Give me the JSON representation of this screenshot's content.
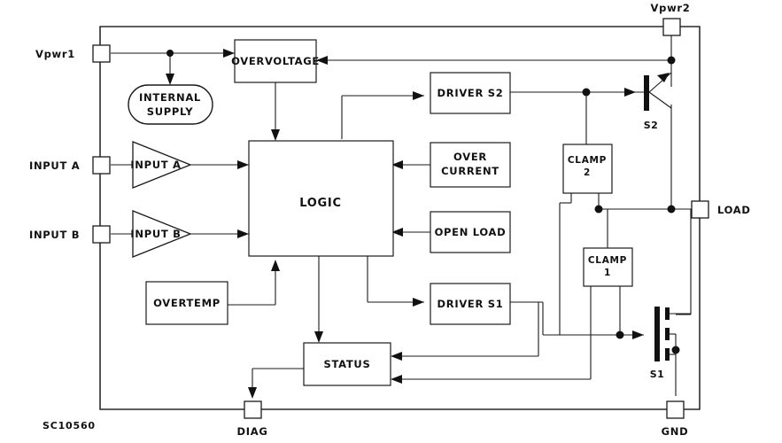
{
  "diagram": {
    "part_number": "SC10560",
    "title": "",
    "line_color": "#1a1a1a",
    "background_color": "#ffffff"
  },
  "terminals": [
    {
      "id": "vpwr1",
      "label": "Vpwr1",
      "side": "left"
    },
    {
      "id": "input_a",
      "label": "INPUT A",
      "side": "left"
    },
    {
      "id": "input_b",
      "label": "INPUT B",
      "side": "left"
    },
    {
      "id": "vpwr2",
      "label": "Vpwr2",
      "side": "top"
    },
    {
      "id": "load",
      "label": "LOAD",
      "side": "right"
    },
    {
      "id": "gnd",
      "label": "GND",
      "side": "bottom"
    },
    {
      "id": "diag",
      "label": "DIAG",
      "side": "bottom"
    }
  ],
  "blocks": [
    {
      "id": "overvoltage",
      "label": "OVERVOLTAGE",
      "shape": "rect"
    },
    {
      "id": "internal_supply",
      "label_line1": "INTERNAL",
      "label_line2": "SUPPLY",
      "shape": "rounded"
    },
    {
      "id": "input_a_buffer",
      "label": "INPUT A",
      "shape": "triangle"
    },
    {
      "id": "input_b_buffer",
      "label": "INPUT B",
      "shape": "triangle"
    },
    {
      "id": "logic",
      "label": "LOGIC",
      "shape": "rect"
    },
    {
      "id": "overtemp",
      "label": "OVERTEMP",
      "shape": "rect"
    },
    {
      "id": "status",
      "label": "STATUS",
      "shape": "rect"
    },
    {
      "id": "driver_s2",
      "label": "DRIVER  S2",
      "shape": "rect"
    },
    {
      "id": "driver_s1",
      "label": "DRIVER  S1",
      "shape": "rect"
    },
    {
      "id": "over_current",
      "label_line1": "OVER",
      "label_line2": "CURRENT",
      "shape": "rect"
    },
    {
      "id": "open_load",
      "label": "OPEN  LOAD",
      "shape": "rect"
    },
    {
      "id": "clamp_2",
      "label_line1": "CLAMP",
      "label_line2": "2",
      "shape": "rect"
    },
    {
      "id": "clamp_1",
      "label_line1": "CLAMP",
      "label_line2": "1",
      "shape": "rect"
    }
  ],
  "devices": [
    {
      "id": "s2",
      "label": "S2",
      "type": "bipolar-transistor"
    },
    {
      "id": "s1",
      "label": "S1",
      "type": "mosfet"
    }
  ]
}
